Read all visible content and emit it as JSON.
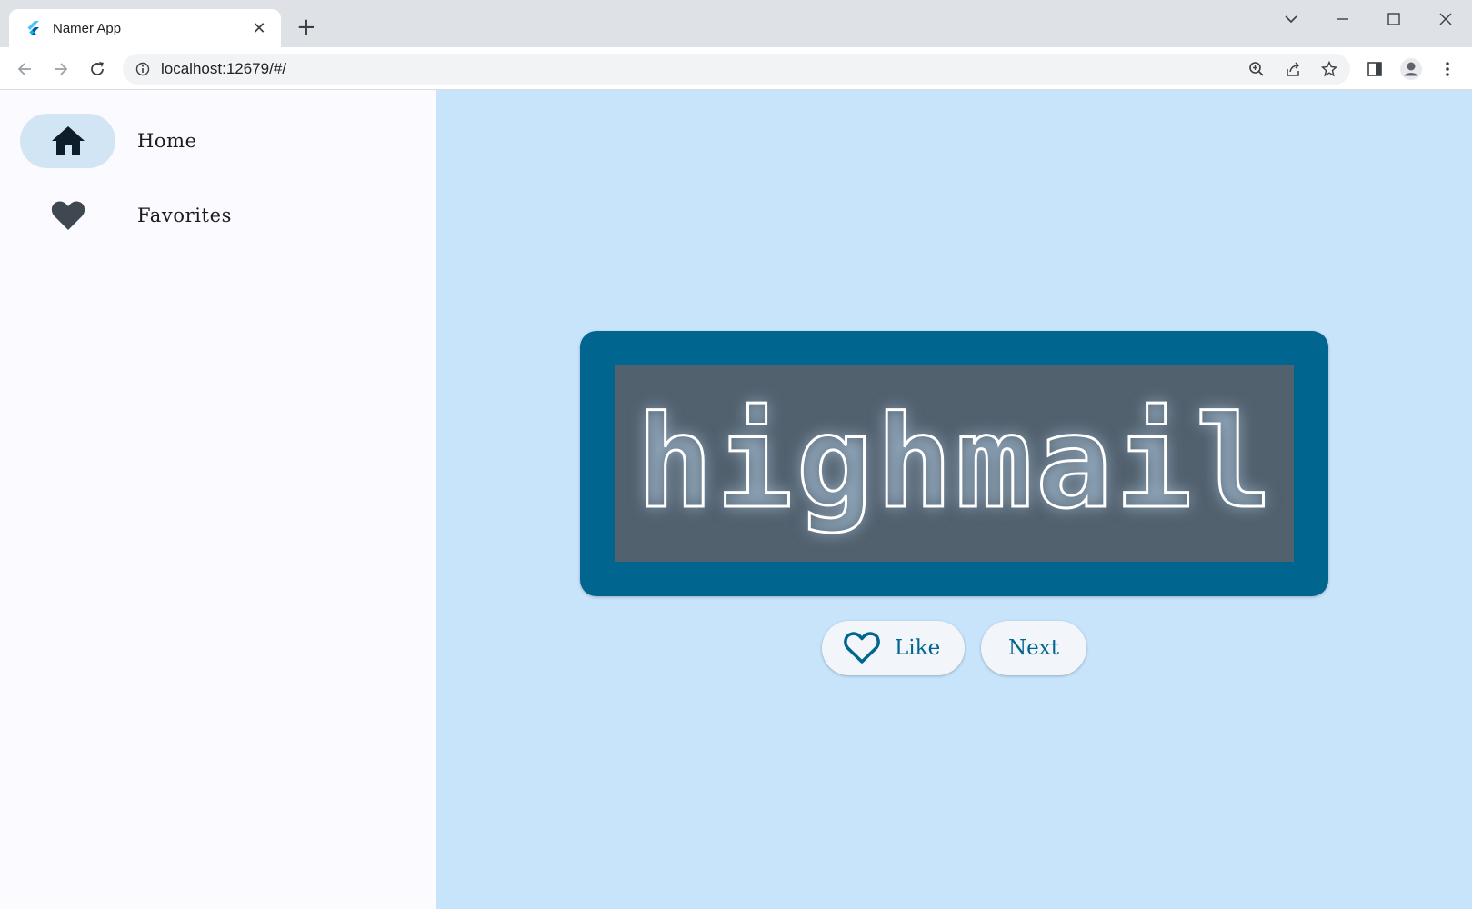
{
  "browser": {
    "tab_title": "Namer App",
    "url": "localhost:12679/#/"
  },
  "nav": {
    "items": [
      {
        "label": "Home",
        "icon": "home-icon",
        "selected": true
      },
      {
        "label": "Favorites",
        "icon": "heart-icon",
        "selected": false
      }
    ]
  },
  "main": {
    "word_pair": "highmail",
    "like_label": "Like",
    "next_label": "Next"
  },
  "colors": {
    "primary": "#00658f",
    "content_bg": "#c8e4fb",
    "rail_bg": "#fbfaff",
    "indicator": "#d2e5f5"
  }
}
